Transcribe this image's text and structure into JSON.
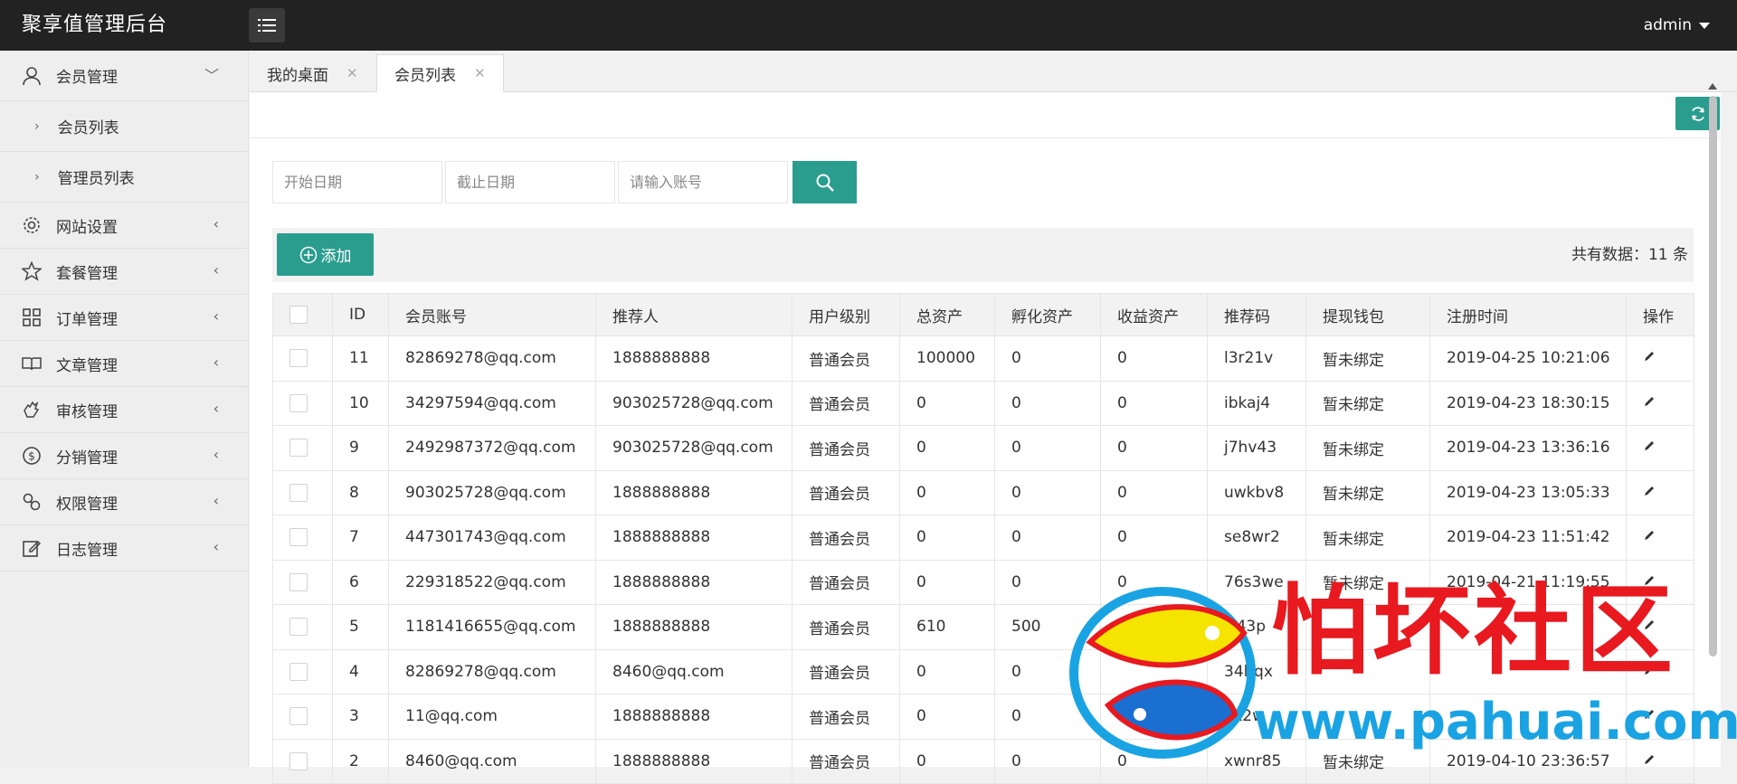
{
  "app": {
    "title": "聚享值管理后台",
    "user": "admin"
  },
  "sidebar": {
    "items": [
      {
        "label": "会员管理",
        "icon": "user-icon",
        "expanded": true,
        "children": [
          {
            "label": "会员列表"
          },
          {
            "label": "管理员列表"
          }
        ]
      },
      {
        "label": "网站设置",
        "icon": "gear-icon"
      },
      {
        "label": "套餐管理",
        "icon": "star-icon"
      },
      {
        "label": "订单管理",
        "icon": "grid-icon"
      },
      {
        "label": "文章管理",
        "icon": "book-icon"
      },
      {
        "label": "审核管理",
        "icon": "hand-icon"
      },
      {
        "label": "分销管理",
        "icon": "dollar-icon"
      },
      {
        "label": "权限管理",
        "icon": "link-icon"
      },
      {
        "label": "日志管理",
        "icon": "edit-icon"
      }
    ]
  },
  "tabs": [
    {
      "label": "我的桌面"
    },
    {
      "label": "会员列表",
      "active": true
    }
  ],
  "filter": {
    "start_placeholder": "开始日期",
    "end_placeholder": "截止日期",
    "account_placeholder": "请输入账号"
  },
  "toolbar": {
    "add_label": "添加",
    "total_label": "共有数据：11 条"
  },
  "table": {
    "columns": [
      "ID",
      "会员账号",
      "推荐人",
      "用户级别",
      "总资产",
      "孵化资产",
      "收益资产",
      "推荐码",
      "提现钱包",
      "注册时间",
      "操作"
    ],
    "rows": [
      [
        "11",
        "82869278@qq.com",
        "1888888888",
        "普通会员",
        "100000",
        "0",
        "0",
        "l3r21v",
        "暂未绑定",
        "2019-04-25 10:21:06"
      ],
      [
        "10",
        "34297594@qq.com",
        "903025728@qq.com",
        "普通会员",
        "0",
        "0",
        "0",
        "ibkaj4",
        "暂未绑定",
        "2019-04-23 18:30:15"
      ],
      [
        "9",
        "2492987372@qq.com",
        "903025728@qq.com",
        "普通会员",
        "0",
        "0",
        "0",
        "j7hv43",
        "暂未绑定",
        "2019-04-23 13:36:16"
      ],
      [
        "8",
        "903025728@qq.com",
        "1888888888",
        "普通会员",
        "0",
        "0",
        "0",
        "uwkbv8",
        "暂未绑定",
        "2019-04-23 13:05:33"
      ],
      [
        "7",
        "447301743@qq.com",
        "1888888888",
        "普通会员",
        "0",
        "0",
        "0",
        "se8wr2",
        "暂未绑定",
        "2019-04-23 11:51:42"
      ],
      [
        "6",
        "229318522@qq.com",
        "1888888888",
        "普通会员",
        "0",
        "0",
        "0",
        "76s3we",
        "暂未绑定",
        "2019-04-21 11:19:55"
      ],
      [
        "5",
        "1181416655@qq.com",
        "1888888888",
        "普通会员",
        "610",
        "500",
        "",
        "si43p",
        "",
        ""
      ],
      [
        "4",
        "82869278@qq.com",
        "8460@qq.com",
        "普通会员",
        "0",
        "0",
        "",
        "34lrqx",
        "",
        ""
      ],
      [
        "3",
        "11@qq.com",
        "1888888888",
        "普通会员",
        "0",
        "0",
        "",
        "ek2w",
        "",
        ""
      ],
      [
        "2",
        "8460@qq.com",
        "1888888888",
        "普通会员",
        "0",
        "0",
        "0",
        "xwnr85",
        "暂未绑定",
        "2019-04-10 23:36:57"
      ]
    ]
  },
  "watermark": {
    "text": "怕坏社区",
    "url": "www.pahuai.com"
  },
  "colors": {
    "header": "#222222",
    "accent": "#2a9d8f",
    "watermark_red": "#e8191f",
    "watermark_blue": "#1aa3e3"
  }
}
